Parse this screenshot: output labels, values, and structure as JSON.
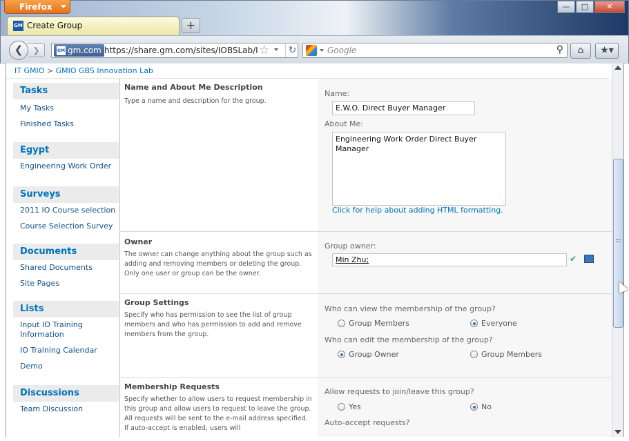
{
  "browser": {
    "menu_label": "Firefox",
    "tab_title": "Create Group",
    "site_badge": "gm.com",
    "url": "https://share.gm.com/sites/IOBSLab/IOITT",
    "search_placeholder": "Google",
    "window_controls": [
      "minimize",
      "maximize",
      "close"
    ]
  },
  "breadcrumb": {
    "root": "IT GMIO",
    "separator": ">",
    "current": "GMIO GBS Innovation Lab"
  },
  "leftnav": {
    "tasks": {
      "heading": "Tasks",
      "items": [
        "My Tasks",
        "Finished Tasks"
      ]
    },
    "egypt": {
      "heading": "Egypt",
      "items": [
        "Engineering Work Order"
      ]
    },
    "surveys": {
      "heading": "Surveys",
      "items": [
        "2011 IO Course selection",
        "Course Selection Survey"
      ]
    },
    "documents": {
      "heading": "Documents",
      "items": [
        "Shared Documents",
        "Site Pages"
      ]
    },
    "lists": {
      "heading": "Lists",
      "items": [
        "Input IO Training Information",
        "IO Training Calendar",
        "Demo"
      ]
    },
    "discussions": {
      "heading": "Discussions",
      "items": [
        "Team Discussion"
      ]
    }
  },
  "form": {
    "name_section": {
      "title": "Name and About Me Description",
      "description": "Type a name and description for the group.",
      "name_label": "Name:",
      "name_value": "E.W.O. Direct Buyer Manager",
      "about_label": "About Me:",
      "about_value": "Engineering Work Order Direct Buyer Manager",
      "help_link": "Click for help about adding HTML formatting."
    },
    "owner_section": {
      "title": "Owner",
      "description": "The owner can change anything about the group such as adding and removing members or deleting the group. Only one user or group can be the owner.",
      "owner_label": "Group owner:",
      "owner_value": "Min Zhu;"
    },
    "settings_section": {
      "title": "Group Settings",
      "description": "Specify who has permission to see the list of group members and who has permission to add and remove members from the group.",
      "view_question": "Who can view the membership of the group?",
      "view_options": [
        "Group Members",
        "Everyone"
      ],
      "view_selected": "Everyone",
      "edit_question": "Who can edit the membership of the group?",
      "edit_options": [
        "Group Owner",
        "Group Members"
      ],
      "edit_selected": "Group Owner"
    },
    "requests_section": {
      "title": "Membership Requests",
      "description": "Specify whether to allow users to request membership in this group and allow users to request to leave the group. All requests will be sent to the e-mail address specified. If auto-accept is enabled, users will",
      "allow_question": "Allow requests to join/leave this group?",
      "allow_options": [
        "Yes",
        "No"
      ],
      "allow_selected": "No",
      "auto_question": "Auto-accept requests?"
    }
  },
  "colors": {
    "link": "#0072bc",
    "firefox_orange": "#e2741b",
    "radio_selected": "#3271c8"
  }
}
